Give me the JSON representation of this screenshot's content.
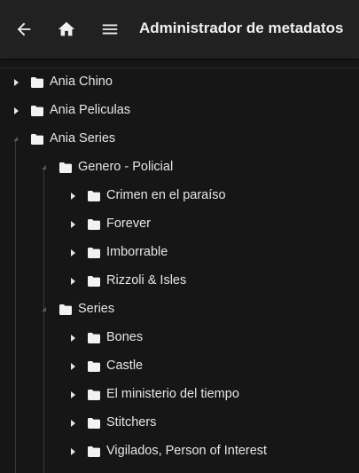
{
  "appbar": {
    "title": "Administrador de metadatos",
    "back_icon": "arrow-left-icon",
    "home_icon": "home-icon",
    "menu_icon": "hamburger-menu-icon"
  },
  "tree": {
    "nodes": [
      {
        "label": "Ania Chino",
        "level": 0,
        "expanded": false
      },
      {
        "label": "Ania Peliculas",
        "level": 0,
        "expanded": false
      },
      {
        "label": "Ania Series",
        "level": 0,
        "expanded": true
      },
      {
        "label": "Genero - Policial",
        "level": 1,
        "expanded": true
      },
      {
        "label": "Crimen en el paraíso",
        "level": 2,
        "expanded": false
      },
      {
        "label": "Forever",
        "level": 2,
        "expanded": false
      },
      {
        "label": "Imborrable",
        "level": 2,
        "expanded": false
      },
      {
        "label": "Rizzoli & Isles",
        "level": 2,
        "expanded": false
      },
      {
        "label": "Series",
        "level": 1,
        "expanded": true
      },
      {
        "label": "Bones",
        "level": 2,
        "expanded": false
      },
      {
        "label": "Castle",
        "level": 2,
        "expanded": false
      },
      {
        "label": "El ministerio del tiempo",
        "level": 2,
        "expanded": false
      },
      {
        "label": "Stitchers",
        "level": 2,
        "expanded": false
      },
      {
        "label": "Vigilados, Person of Interest",
        "level": 2,
        "expanded": false
      }
    ]
  },
  "colors": {
    "background": "#161616",
    "appbar": "#212121",
    "text": "#e6e6e6",
    "folder": "#f2f2f2",
    "guide_line": "#3a3a3a"
  }
}
